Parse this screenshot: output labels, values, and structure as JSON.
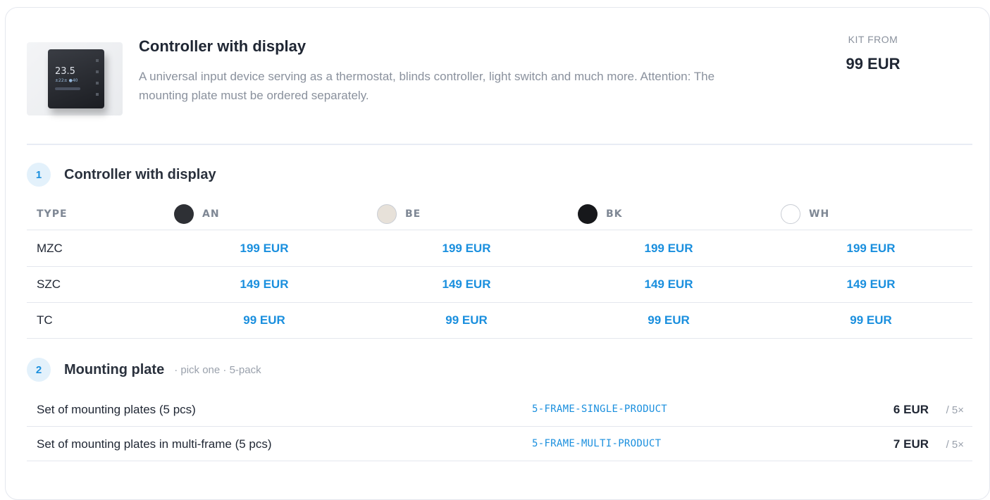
{
  "header": {
    "title": "Controller with display",
    "description": "A universal input device serving as a thermostat, blinds controller, light switch and much more. Attention: The mounting plate must be ordered separately.",
    "kit_label": "KIT FROM",
    "kit_price": "99 EUR",
    "device_screen": {
      "temp": "23.5",
      "sub": "±22± ●40"
    }
  },
  "section1": {
    "number": "1",
    "title": "Controller with display",
    "type_header": "TYPE",
    "colors": [
      {
        "code": "AN",
        "hex": "#2e3035"
      },
      {
        "code": "BE",
        "hex": "#e7e1d9"
      },
      {
        "code": "BK",
        "hex": "#17181b"
      },
      {
        "code": "WH",
        "hex": "#ffffff"
      }
    ],
    "rows": [
      {
        "type": "MZC",
        "prices": [
          "199 EUR",
          "199 EUR",
          "199 EUR",
          "199 EUR"
        ]
      },
      {
        "type": "SZC",
        "prices": [
          "149 EUR",
          "149 EUR",
          "149 EUR",
          "149 EUR"
        ]
      },
      {
        "type": "TC",
        "prices": [
          "99 EUR",
          "99 EUR",
          "99 EUR",
          "99 EUR"
        ]
      }
    ]
  },
  "section2": {
    "number": "2",
    "title": "Mounting plate",
    "subtitle": "· pick one · 5-pack",
    "items": [
      {
        "name": "Set of mounting plates (5 pcs)",
        "code": "5-FRAME-SINGLE-PRODUCT",
        "price": "6 EUR",
        "qty": "/ 5×"
      },
      {
        "name": "Set of mounting plates in multi-frame (5 pcs)",
        "code": "5-FRAME-MULTI-PRODUCT",
        "price": "7 EUR",
        "qty": "/ 5×"
      }
    ]
  },
  "colors": {
    "accent": "#1a8fde",
    "text": "#1f2633",
    "muted": "#8a919d"
  }
}
